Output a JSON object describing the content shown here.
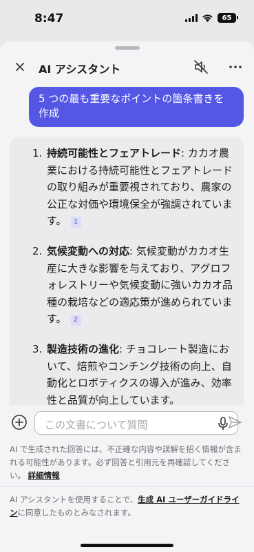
{
  "status_bar": {
    "time": "8:47",
    "battery": "65"
  },
  "header": {
    "title": "AI アシスタント"
  },
  "chat": {
    "user_message": "5 つの最も重要なポイントの箇条書きを作成",
    "answer": [
      {
        "number": "1.",
        "title": "持続可能性とフェアトレード",
        "body": ": カカオ農業における持続可能性とフェアトレードの取り組みが重要視されており、農家の公正な対価や環境保全が強調されています。",
        "citation": "1"
      },
      {
        "number": "2.",
        "title": "気候変動への対応",
        "body": ": 気候変動がカカオ生産に大きな影響を与えており、アグロフォレストリーや気候変動に強いカカオ品種の栽培などの適応策が進められています。",
        "citation": "2"
      },
      {
        "number": "3.",
        "title": "製造技術の進化",
        "body": ": チョコレート製造において、焙煎やコンチング技術の向上、自動化とロボティクスの導入が進み、効率性と品質が向上しています。",
        "citation": ""
      }
    ]
  },
  "composer": {
    "placeholder": "この文書について質問"
  },
  "disclaimer": {
    "text": "AI で生成された回答には、不正確な内容や誤解を招く情報が含まれる可能性があります。必ず回答と引用元を再確認してください。",
    "link": "詳細情報"
  },
  "terms": {
    "prefix": "AI アシスタントを使用することで、",
    "link": "生成 AI ユーザーガイドライン",
    "suffix": "に同意したものとみなされます。"
  },
  "colors": {
    "accent": "#5457e4",
    "citation_bg": "#dcdcf6",
    "sheet_bg": "#f4f4f6"
  },
  "icons": [
    "close-icon",
    "speaker-mute-icon",
    "more-icon",
    "arrow-down-icon",
    "plus-circle-icon",
    "microphone-icon",
    "send-icon"
  ]
}
